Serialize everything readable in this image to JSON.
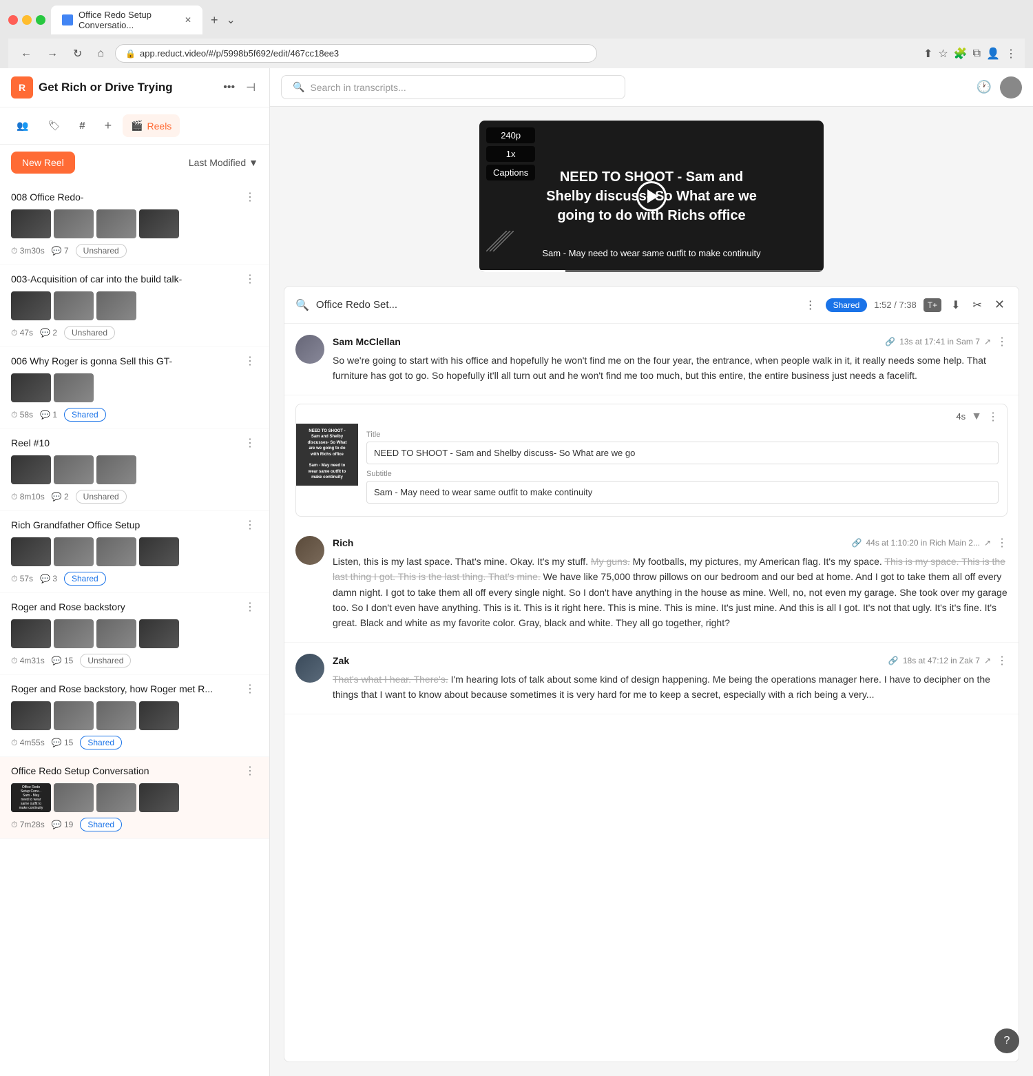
{
  "browser": {
    "tab_title": "Office Redo Setup Conversatio...",
    "url": "app.reduct.video/#/p/5998b5f692/edit/467cc18ee3",
    "new_tab_label": "+",
    "nav_back": "←",
    "nav_forward": "→",
    "nav_refresh": "↻",
    "nav_home": "⌂"
  },
  "app": {
    "logo_label": "R",
    "project_title": "Get Rich or Drive Trying",
    "search_placeholder": "Search in transcripts...",
    "more_icon": "•••",
    "collapse_icon": "⊣"
  },
  "sidebar_tabs": [
    {
      "id": "people",
      "icon": "👥",
      "label": ""
    },
    {
      "id": "tags",
      "icon": "🏷",
      "label": ""
    },
    {
      "id": "hashtag",
      "icon": "#",
      "label": ""
    },
    {
      "id": "add",
      "icon": "+",
      "label": ""
    },
    {
      "id": "reels",
      "icon": "🎬",
      "label": "Reels",
      "active": true
    }
  ],
  "sidebar_toolbar": {
    "new_reel_label": "New Reel",
    "sort_label": "Last Modified",
    "sort_arrow": "▼"
  },
  "reels": [
    {
      "id": "reel1",
      "title": "008 Office Redo-",
      "duration": "3m30s",
      "clips": "7",
      "badge": "Unshared",
      "badge_type": "unshared",
      "thumbs": [
        "dark",
        "gray",
        "gray",
        "gray"
      ]
    },
    {
      "id": "reel2",
      "title": "003-Acquisition of car into the build talk-",
      "duration": "47s",
      "clips": "2",
      "badge": "Unshared",
      "badge_type": "unshared",
      "thumbs": [
        "dark",
        "gray",
        "gray"
      ]
    },
    {
      "id": "reel3",
      "title": "006 Why Roger is gonna Sell this GT-",
      "duration": "58s",
      "clips": "1",
      "badge": "Shared",
      "badge_type": "shared",
      "thumbs": [
        "dark",
        "gray"
      ]
    },
    {
      "id": "reel4",
      "title": "Reel #10",
      "duration": "8m10s",
      "clips": "2",
      "badge": "Unshared",
      "badge_type": "unshared",
      "thumbs": [
        "dark",
        "gray",
        "gray"
      ]
    },
    {
      "id": "reel5",
      "title": "Rich Grandfather Office Setup",
      "duration": "57s",
      "clips": "3",
      "badge": "Shared",
      "badge_type": "shared",
      "thumbs": [
        "dark",
        "gray",
        "gray",
        "gray"
      ]
    },
    {
      "id": "reel6",
      "title": "Roger and Rose backstory",
      "duration": "4m31s",
      "clips": "15",
      "badge": "Unshared",
      "badge_type": "unshared",
      "thumbs": [
        "dark",
        "gray",
        "gray",
        "gray"
      ]
    },
    {
      "id": "reel7",
      "title": "Roger and Rose backstory, how Roger met R...",
      "duration": "4m55s",
      "clips": "15",
      "badge": "Shared",
      "badge_type": "shared",
      "thumbs": [
        "dark",
        "gray",
        "gray",
        "gray"
      ]
    },
    {
      "id": "reel8",
      "title": "Office Redo Setup Conversation",
      "duration": "7m28s",
      "clips": "19",
      "badge": "Shared",
      "badge_type": "shared",
      "thumbs": [
        "dark",
        "gray",
        "gray",
        "gray"
      ],
      "active": true
    }
  ],
  "video": {
    "quality_label": "240p",
    "speed_label": "1x",
    "captions_label": "Captions",
    "overlay_line1": "NEED TO SHOOT - Sam and",
    "overlay_line2": "Shelby discuss- So What are we",
    "overlay_line3": "going to do with Richs office",
    "subtitle": "Sam - May need to wear same outfit to make continuity",
    "time_current": "1:52",
    "time_total": "7:38"
  },
  "panel": {
    "icon": "🔍",
    "title": "Office Redo Set...",
    "badge": "Shared",
    "time": "1:52 / 7:38",
    "tplus_label": "T+",
    "download_label": "⬇",
    "clip_label": "✂",
    "close_label": "✕"
  },
  "comments": [
    {
      "id": "c1",
      "author": "Sam McClellan",
      "meta": "13s at 17:41 in Sam 7",
      "meta_icon": "🔗",
      "text": "So we're going to start with his office and hopefully he won't find me on the four year, the entrance, when people walk in it, it really needs some help. That furniture has got to go. So hopefully it'll all turn out and he won't find me too much, but this entire, the entire business just needs a facelift.",
      "strikethrough": false
    }
  ],
  "clip_card": {
    "thumb_line1": "NEED TO SHOOT -",
    "thumb_line2": "Sam and Shelby",
    "thumb_line3": "discusses- So What",
    "thumb_line4": "are we going to do with",
    "thumb_line5": "Richs office",
    "thumb_line6": "Sam - May need to",
    "thumb_line7": "wear same outfit to",
    "thumb_line8": "make continuity",
    "duration_label": "4s",
    "title_label": "Title",
    "title_value": "NEED TO SHOOT - Sam and Shelby discuss- So What are we go",
    "subtitle_label": "Subtitle",
    "subtitle_value": "Sam - May need to wear same outfit to make continuity"
  },
  "rich_comment": {
    "author": "Rich",
    "meta": "44s at 1:10:20 in Rich Main 2...",
    "meta_icon": "🔗",
    "text_normal": "Listen, this is my last space. That's mine. Okay. It's my stuff. ",
    "text_strike1": "My guns.",
    "text_after_strike1": " My footballs, my pictures, my American flag. It's my space. ",
    "text_strike2": "This is my space. This is the last thing I got. This is the last thing. That's mine.",
    "text_after_strike2": " We have like 75,000 throw pillows on our bedroom and our bed at home. And I got to take them all off every damn night. I got to take them all off every single night. So I don't have anything in the house as mine. Well, no, not even my garage. She took over my garage too. So I don't even have anything. This is it. This is it right here. This is mine. This is mine. It's just mine. And this is all I got. It's not that ugly. It's it's fine. It's great. Black and white as my favorite color. Gray, black and white. They all go together, right?"
  },
  "zak_comment": {
    "author": "Zak",
    "meta": "18s at 47:12 in Zak 7",
    "meta_icon": "🔗",
    "text_strike": "That's what I hear. There's.",
    "text_normal": " I'm hearing lots of talk about some kind of design happening. Me being the operations manager here. I have to decipher on the things that I want to know about because sometimes it is very hard for me to keep a secret, especially with a rich being a very..."
  },
  "help_icon": "?"
}
